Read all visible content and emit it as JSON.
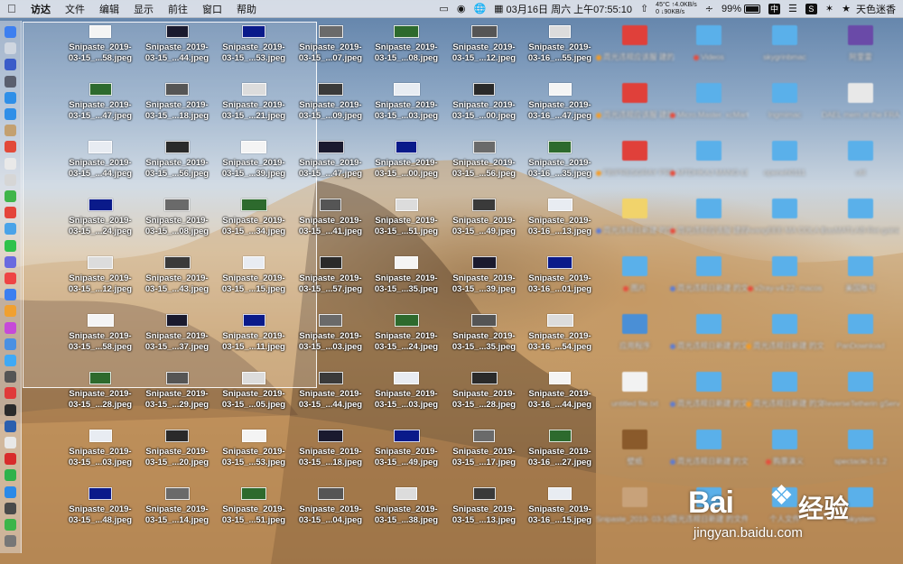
{
  "menubar": {
    "app_name": "访达",
    "menus": [
      "文件",
      "编辑",
      "显示",
      "前往",
      "窗口",
      "帮助"
    ],
    "datetime": "03月16日 周六 上午07:55:10",
    "cpu_temp": "45°C",
    "net_up": "↑4.0KB/s",
    "net_count": "0",
    "net_down": "↓90KB/s",
    "battery_percent": "99%",
    "battery_level": 0.99,
    "input_method": "中",
    "user_name": "天色迷香",
    "icons": [
      "apple-icon",
      "screen-icon",
      "bell-icon",
      "globe-icon",
      "calendar-icon",
      "up-arrow-icon",
      "wifi-icon",
      "battery-icon",
      "input-method-icon",
      "snipaste-icon",
      "bluetooth-icon",
      "star-icon"
    ]
  },
  "desktop": {
    "files": [
      [
        "Snipaste_2019-",
        "03-15_...58.jpeg"
      ],
      [
        "Snipaste_2019-",
        "03-15_...44.jpeg"
      ],
      [
        "Snipaste_2019-",
        "03-15_...53.jpeg"
      ],
      [
        "Snipaste_2019-",
        "03-15_...07.jpeg"
      ],
      [
        "Snipaste_2019-",
        "03-15_...08.jpeg"
      ],
      [
        "Snipaste_2019-",
        "03-15_...12.jpeg"
      ],
      [
        "Snipaste_2019-",
        "03-16_...55.jpeg"
      ],
      [
        "Snipaste_2019-",
        "03-15_...47.jpeg"
      ],
      [
        "Snipaste_2019-",
        "03-15_...18.jpeg"
      ],
      [
        "Snipaste_2019-",
        "03-15_...21.jpeg"
      ],
      [
        "Snipaste_2019-",
        "03-15_...09.jpeg"
      ],
      [
        "Snipaste_2019-",
        "03-15_...03.jpeg"
      ],
      [
        "Snipaste_2019-",
        "03-15_...00.jpeg"
      ],
      [
        "Snipaste_2019-",
        "03-16_...47.jpeg"
      ],
      [
        "Snipaste_2019-",
        "03-15_...44.jpeg"
      ],
      [
        "Snipaste_2019-",
        "03-15_...56.jpeg"
      ],
      [
        "Snipaste_2019-",
        "03-15_...39.jpeg"
      ],
      [
        "Snipaste_2019-",
        "03-15_...47.jpeg"
      ],
      [
        "Snipaste_2019-",
        "03-15_...00.jpeg"
      ],
      [
        "Snipaste_2019-",
        "03-15_...56.jpeg"
      ],
      [
        "Snipaste_2019-",
        "03-16_...35.jpeg"
      ],
      [
        "Snipaste_2019-",
        "03-15_...24.jpeg"
      ],
      [
        "Snipaste_2019-",
        "03-15_...08.jpeg"
      ],
      [
        "Snipaste_2019-",
        "03-15_...34.jpeg"
      ],
      [
        "Snipaste_2019-",
        "03-15_...41.jpeg"
      ],
      [
        "Snipaste_2019-",
        "03-15_...51.jpeg"
      ],
      [
        "Snipaste_2019-",
        "03-15_...49.jpeg"
      ],
      [
        "Snipaste_2019-",
        "03-16_...13.jpeg"
      ],
      [
        "Snipaste_2019-",
        "03-15_...12.jpeg"
      ],
      [
        "Snipaste_2019-",
        "03-15_...43.jpeg"
      ],
      [
        "Snipaste_2019-",
        "03-15_...15.jpeg"
      ],
      [
        "Snipaste_2019-",
        "03-15_...57.jpeg"
      ],
      [
        "Snipaste_2019-",
        "03-15_...35.jpeg"
      ],
      [
        "Snipaste_2019-",
        "03-15_...39.jpeg"
      ],
      [
        "Snipaste_2019-",
        "03-16_...01.jpeg"
      ],
      [
        "Snipaste_2019-",
        "03-15_...58.jpeg"
      ],
      [
        "Snipaste_2019-",
        "03-15_...37.jpeg"
      ],
      [
        "Snipaste_2019-",
        "03-15_...11.jpeg"
      ],
      [
        "Snipaste_2019-",
        "03-15_...03.jpeg"
      ],
      [
        "Snipaste_2019-",
        "03-15_...24.jpeg"
      ],
      [
        "Snipaste_2019-",
        "03-15_...35.jpeg"
      ],
      [
        "Snipaste_2019-",
        "03-16_...54.jpeg"
      ],
      [
        "Snipaste_2019-",
        "03-15_...28.jpeg"
      ],
      [
        "Snipaste_2019-",
        "03-15_...29.jpeg"
      ],
      [
        "Snipaste_2019-",
        "03-15_...05.jpeg"
      ],
      [
        "Snipaste_2019-",
        "03-15_...44.jpeg"
      ],
      [
        "Snipaste_2019-",
        "03-15_...03.jpeg"
      ],
      [
        "Snipaste_2019-",
        "03-15_...28.jpeg"
      ],
      [
        "Snipaste_2019-",
        "03-16_...44.jpeg"
      ],
      [
        "Snipaste_2019-",
        "03-15_...03.jpeg"
      ],
      [
        "Snipaste_2019-",
        "03-15_...20.jpeg"
      ],
      [
        "Snipaste_2019-",
        "03-15_...53.jpeg"
      ],
      [
        "Snipaste_2019-",
        "03-15_...18.jpeg"
      ],
      [
        "Snipaste_2019-",
        "03-15_...49.jpeg"
      ],
      [
        "Snipaste_2019-",
        "03-15_...17.jpeg"
      ],
      [
        "Snipaste_2019-",
        "03-16_...27.jpeg"
      ],
      [
        "Snipaste_2019-",
        "03-15_...48.jpeg"
      ],
      [
        "Snipaste_2019-",
        "03-15_...14.jpeg"
      ],
      [
        "Snipaste_2019-",
        "03-15_...51.jpeg"
      ],
      [
        "Snipaste_2019-",
        "03-15_...04.jpeg"
      ],
      [
        "Snipaste_2019-",
        "03-15_...38.jpeg"
      ],
      [
        "Snipaste_2019-",
        "03-15_...13.jpeg"
      ],
      [
        "Snipaste_2019-",
        "03-16_...15.jpeg"
      ]
    ],
    "right_items": [
      {
        "label": "周光违规应该服 建的文件夹 6",
        "icon": "red-folder-icon",
        "color": "#e0403a",
        "tag": "#f39c27"
      },
      {
        "label": "Videos",
        "icon": "folder-icon",
        "color": "#5ab0ea",
        "tag": "#e74c3c"
      },
      {
        "label": "skygrinbmac",
        "icon": "folder-icon",
        "color": "#5ab0ea",
        "tag": ""
      },
      {
        "label": "阿里雷",
        "icon": "app-icon",
        "color": "#6a4aa8",
        "tag": ""
      },
      {
        "label": "周光违规应该服 建的文件夹 8",
        "icon": "red-folder-icon",
        "color": "#e0403a",
        "tag": "#f39c27"
      },
      {
        "label": "Micro.Master. xcMart_HATTO",
        "icon": "folder-icon",
        "color": "#5ab0ea",
        "tag": "#e74c3c"
      },
      {
        "label": "Ingmimac",
        "icon": "folder-icon",
        "color": "#5ab0ea",
        "tag": ""
      },
      {
        "label": "DAEL mem at the FRANKA",
        "icon": "document-icon",
        "color": "#e8e8e8",
        "tag": ""
      },
      {
        "label": "FBIPRESGRAY PRESSES",
        "icon": "red-folder-icon",
        "color": "#e0403a",
        "tag": "#f39c27"
      },
      {
        "label": "MTDHKAJ MANG-LEES",
        "icon": "folder-icon",
        "color": "#5ab0ea",
        "tag": "#e74c3c"
      },
      {
        "label": "openeh0111",
        "icon": "folder-icon",
        "color": "#5ab0ea",
        "tag": ""
      },
      {
        "label": "util",
        "icon": "folder-icon",
        "color": "#5ab0ea",
        "tag": ""
      },
      {
        "label": "周光违规日新建 的文件夹 2",
        "icon": "yellow-folder-icon",
        "color": "#f1d36b",
        "tag": "#5b7bd5"
      },
      {
        "label": "周光违规应该服 建的文件夹 10",
        "icon": "folder-icon",
        "color": "#5ab0ea",
        "tag": "#e74c3c"
      },
      {
        "label": "AvangEEE MA COLA-LOO",
        "icon": "folder-icon",
        "color": "#5ab0ea",
        "tag": ""
      },
      {
        "label": "BasMATLAB-Ret gainiat-master",
        "icon": "folder-icon",
        "color": "#5ab0ea",
        "tag": ""
      },
      {
        "label": "图片",
        "icon": "folder-icon",
        "color": "#5ab0ea",
        "tag": "#e74c3c"
      },
      {
        "label": "周光违规日新建 的文件夹 9",
        "icon": "folder-icon",
        "color": "#5ab0ea",
        "tag": "#5b7bd5"
      },
      {
        "label": "v2ray-v4.22- macos",
        "icon": "folder-icon",
        "color": "#5ab0ea",
        "tag": "#e74c3c"
      },
      {
        "label": "美国账号",
        "icon": "folder-icon",
        "color": "#5ab0ea",
        "tag": ""
      },
      {
        "label": "应用程序",
        "icon": "app-icon",
        "color": "#4a8fd6",
        "tag": ""
      },
      {
        "label": "周光违规日新建 的文件夹 11",
        "icon": "folder-icon",
        "color": "#5ab0ea",
        "tag": "#5b7bd5"
      },
      {
        "label": "周光违规日新建 的文件夹 13",
        "icon": "folder-icon",
        "color": "#5ab0ea",
        "tag": "#f39c27"
      },
      {
        "label": "PanDownload",
        "icon": "folder-icon",
        "color": "#5ab0ea",
        "tag": ""
      },
      {
        "label": "untitled file.txt",
        "icon": "document-icon",
        "color": "#f2f2f2",
        "tag": ""
      },
      {
        "label": "周光违规日新建 的文件夹 7",
        "icon": "folder-icon",
        "color": "#5ab0ea",
        "tag": "#5b7bd5"
      },
      {
        "label": "周光违规日新建 的文件夹 12",
        "icon": "folder-icon",
        "color": "#5ab0ea",
        "tag": "#f39c27"
      },
      {
        "label": "ReverseTetherin gServer_1.2.0",
        "icon": "folder-icon",
        "color": "#5ab0ea",
        "tag": ""
      },
      {
        "label": "壁纸",
        "icon": "image-folder-icon",
        "color": "#8a5a2b",
        "tag": ""
      },
      {
        "label": "周光违规日新建 的文件夹 3",
        "icon": "folder-icon",
        "color": "#5ab0ea",
        "tag": "#5b7bd5"
      },
      {
        "label": "购票演义",
        "icon": "folder-icon",
        "color": "#5ab0ea",
        "tag": "#e74c3c"
      },
      {
        "label": "spectacle-1-1.2",
        "icon": "folder-icon",
        "color": "#5ab0ea",
        "tag": ""
      },
      {
        "label": "Snipaste_2019- 03-16_...08.jpeg",
        "icon": "image-icon",
        "color": "#c8a27a",
        "tag": ""
      },
      {
        "label": "周光违规日新建 的文件夹 4",
        "icon": "folder-icon",
        "color": "#5ab0ea",
        "tag": ""
      },
      {
        "label": "个人文件",
        "icon": "folder-icon",
        "color": "#5ab0ea",
        "tag": ""
      },
      {
        "label": "ekystem",
        "icon": "folder-icon",
        "color": "#5ab0ea",
        "tag": ""
      }
    ]
  },
  "watermark": {
    "brand": "Bai",
    "brand_suffix": "经验",
    "url": "jingyan.baidu.com"
  }
}
